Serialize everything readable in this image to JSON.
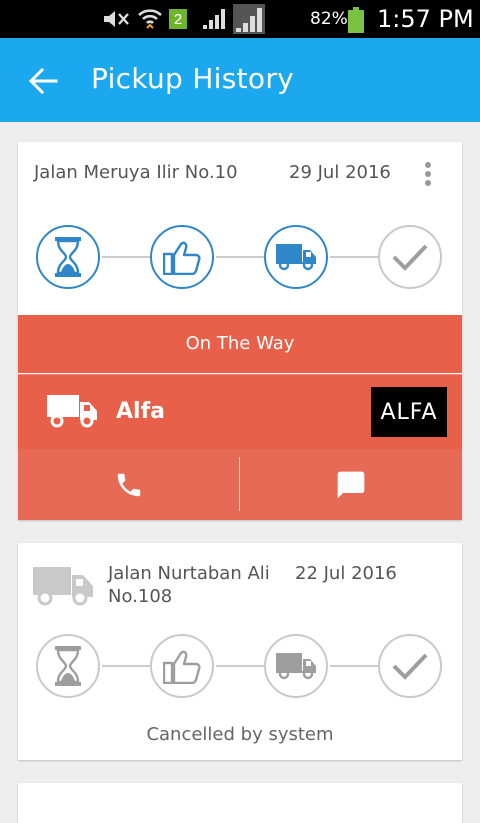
{
  "status_bar": {
    "battery_pct": "82%",
    "time": "1:57 PM",
    "notification_count": "2",
    "icons": [
      "mute-icon",
      "wifi-icon",
      "notification-badge",
      "signal-icon",
      "signal-icon",
      "battery-icon"
    ]
  },
  "app_bar": {
    "title": "Pickup History",
    "back_icon": "back-arrow-icon",
    "color": "#1ba8ee"
  },
  "pickups": [
    {
      "address": "Jalan Meruya Ilir No.10",
      "date": "29 Jul 2016",
      "steps": [
        "hourglass-icon",
        "thumbs-up-icon",
        "truck-icon",
        "check-icon"
      ],
      "active_steps": 3,
      "status": "On The Way",
      "driver_name": "Alfa",
      "driver_badge": "ALFA",
      "actions": [
        "phone-icon",
        "message-icon"
      ],
      "status_color": "#e8604a"
    },
    {
      "address_line1": "Jalan Nurtaban Ali",
      "address_line2": "No.108",
      "date": "22 Jul 2016",
      "steps": [
        "hourglass-icon",
        "thumbs-up-icon",
        "truck-icon",
        "check-icon"
      ],
      "active_steps": 0,
      "status": "Cancelled by system"
    }
  ]
}
